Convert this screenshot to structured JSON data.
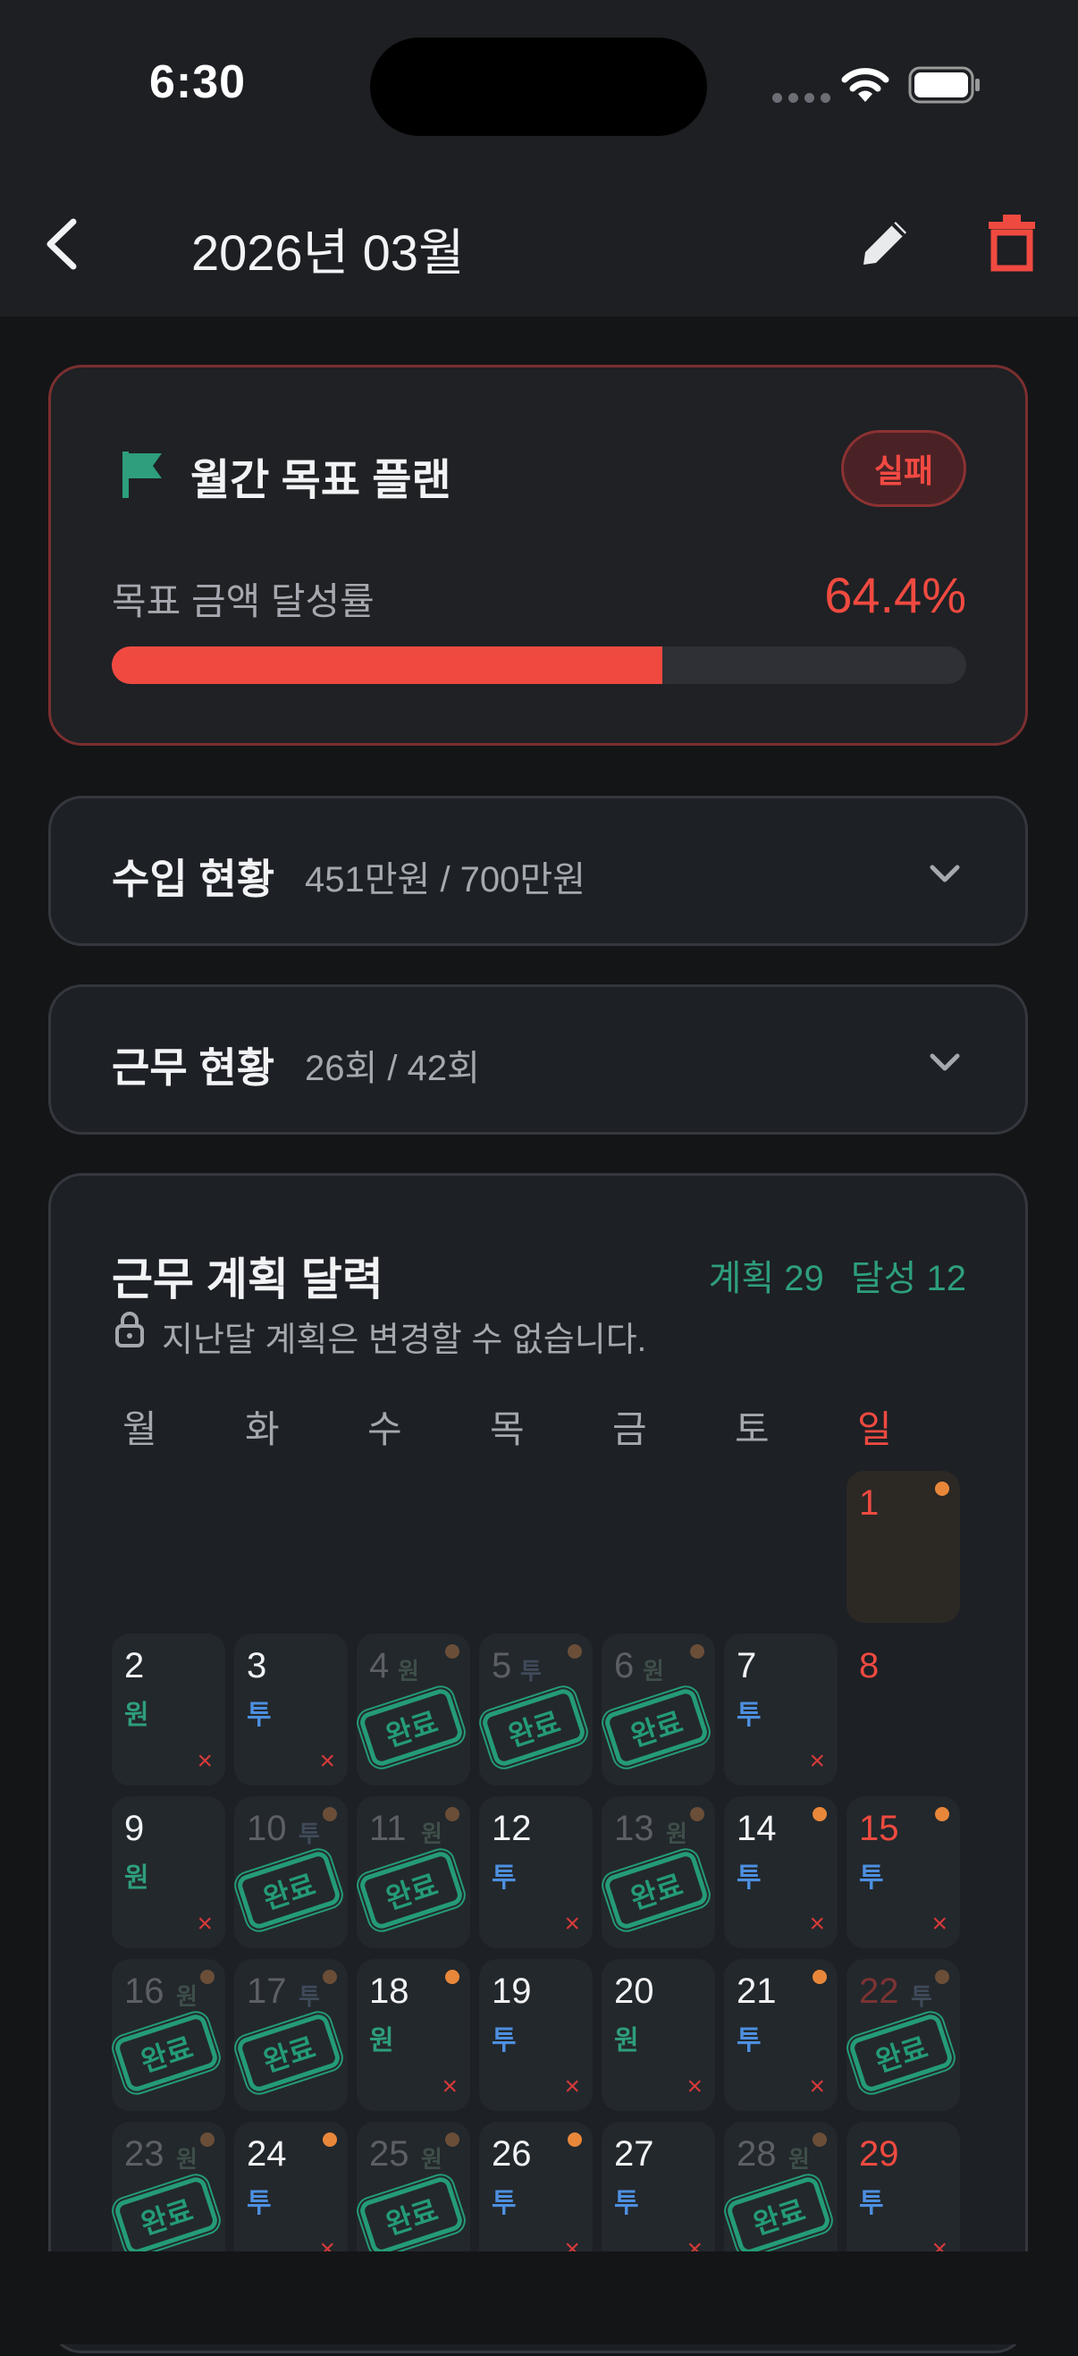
{
  "status_bar": {
    "time": "6:30"
  },
  "header": {
    "title": "2026년 03월",
    "back_icon": "chevron-left-icon",
    "edit_icon": "pencil-icon",
    "delete_icon": "trash-icon"
  },
  "goal": {
    "title": "월간 목표 플랜",
    "badge": "실패",
    "rate_label": "목표 금액 달성률",
    "rate_value": "64.4%",
    "progress": 0.644,
    "accent": "#F04A40"
  },
  "income": {
    "title": "수입 현황",
    "summary": "451만원 / 700만원"
  },
  "work": {
    "title": "근무 현황",
    "summary": "26회 / 42회"
  },
  "calendar": {
    "title": "근무 계획 달력",
    "planned": "계획 29",
    "achieved": "달성 12",
    "note": "지난달 계획은 변경할 수 없습니다.",
    "weekdays": [
      "월",
      "화",
      "수",
      "목",
      "금",
      "토",
      "일"
    ],
    "stamp_text": "완료",
    "fail_mark": "×",
    "days": [
      {
        "day": "1",
        "plan": "",
        "status": "today",
        "dot": true
      },
      {
        "day": "2",
        "plan": "원",
        "status": "fail",
        "dot": false
      },
      {
        "day": "3",
        "plan": "투",
        "status": "fail",
        "dot": false
      },
      {
        "day": "4",
        "plan": "원",
        "status": "done",
        "dot": true
      },
      {
        "day": "5",
        "plan": "투",
        "status": "done",
        "dot": true
      },
      {
        "day": "6",
        "plan": "원",
        "status": "done",
        "dot": true
      },
      {
        "day": "7",
        "plan": "투",
        "status": "fail",
        "dot": false
      },
      {
        "day": "8",
        "plan": "",
        "status": "none",
        "dot": false
      },
      {
        "day": "9",
        "plan": "원",
        "status": "fail",
        "dot": false
      },
      {
        "day": "10",
        "plan": "투",
        "status": "done",
        "dot": true
      },
      {
        "day": "11",
        "plan": "원",
        "status": "done",
        "dot": true
      },
      {
        "day": "12",
        "plan": "투",
        "status": "fail",
        "dot": false
      },
      {
        "day": "13",
        "plan": "원",
        "status": "done",
        "dot": true
      },
      {
        "day": "14",
        "plan": "투",
        "status": "fail",
        "dot": true
      },
      {
        "day": "15",
        "plan": "투",
        "status": "fail",
        "dot": true
      },
      {
        "day": "16",
        "plan": "원",
        "status": "done",
        "dot": true
      },
      {
        "day": "17",
        "plan": "투",
        "status": "done",
        "dot": true
      },
      {
        "day": "18",
        "plan": "원",
        "status": "fail",
        "dot": true
      },
      {
        "day": "19",
        "plan": "투",
        "status": "fail",
        "dot": false
      },
      {
        "day": "20",
        "plan": "원",
        "status": "fail",
        "dot": false
      },
      {
        "day": "21",
        "plan": "투",
        "status": "fail",
        "dot": true
      },
      {
        "day": "22",
        "plan": "투",
        "status": "done",
        "dot": true
      },
      {
        "day": "23",
        "plan": "원",
        "status": "done",
        "dot": true
      },
      {
        "day": "24",
        "plan": "투",
        "status": "fail",
        "dot": true
      },
      {
        "day": "25",
        "plan": "원",
        "status": "done",
        "dot": true
      },
      {
        "day": "26",
        "plan": "투",
        "status": "fail",
        "dot": true
      },
      {
        "day": "27",
        "plan": "투",
        "status": "fail",
        "dot": false
      },
      {
        "day": "28",
        "plan": "원",
        "status": "done",
        "dot": true
      },
      {
        "day": "29",
        "plan": "투",
        "status": "fail",
        "dot": false
      }
    ]
  }
}
